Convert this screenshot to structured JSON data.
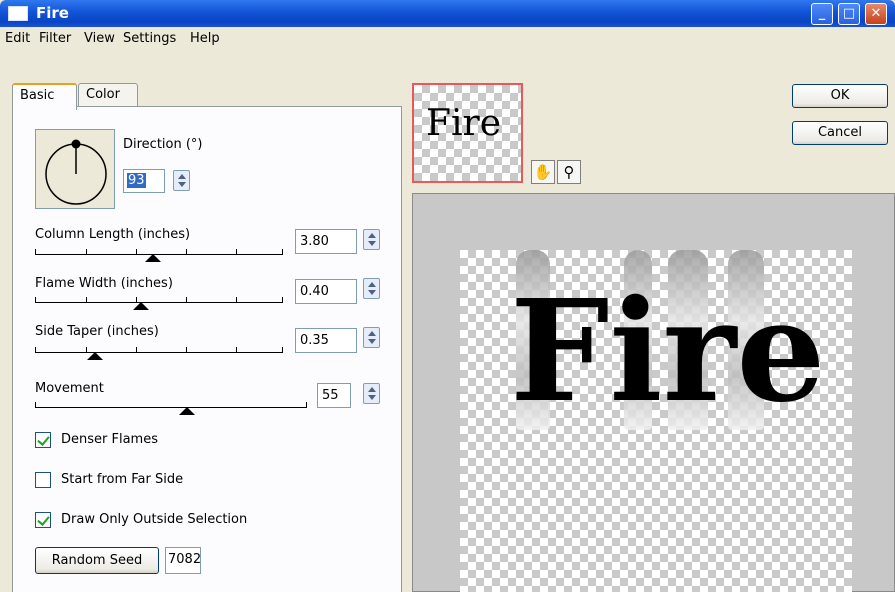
{
  "window": {
    "title": "Fire"
  },
  "menu": [
    "Edit",
    "Filter",
    "View",
    "Settings",
    "Help"
  ],
  "tabs": [
    "Basic",
    "Color"
  ],
  "direction": {
    "label": "Direction (°)",
    "value": "93"
  },
  "sliders": [
    {
      "label": "Column Length (inches)",
      "value": "3.80"
    },
    {
      "label": "Flame Width (inches)",
      "value": "0.40"
    },
    {
      "label": "Side Taper (inches)",
      "value": "0.35"
    },
    {
      "label": "Movement",
      "value": "55"
    }
  ],
  "checkboxes": [
    {
      "label": "Denser Flames",
      "checked": true
    },
    {
      "label": "Start from Far Side",
      "checked": false
    },
    {
      "label": "Draw Only Outside Selection",
      "checked": true
    }
  ],
  "random_seed": {
    "label": "Random Seed",
    "value": "7082"
  },
  "preview": {
    "thumbnail_text": "Fire",
    "text": "Fire"
  },
  "buttons": {
    "ok": "OK",
    "cancel": "Cancel"
  },
  "icons": {
    "hand": "hand-pan-icon",
    "zoom": "magnifier-icon"
  }
}
